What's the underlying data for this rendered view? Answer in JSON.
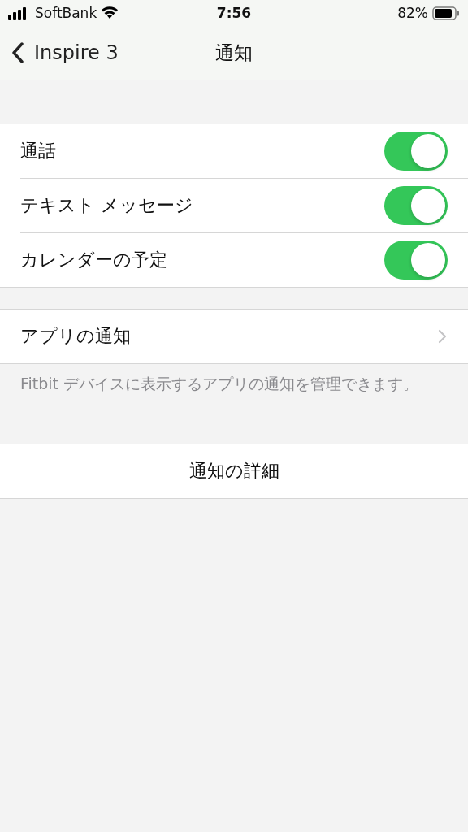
{
  "status_bar": {
    "carrier": "SoftBank",
    "time": "7:56",
    "battery": "82%"
  },
  "nav": {
    "back_label": "Inspire 3",
    "title": "通知"
  },
  "toggles": [
    {
      "label": "通話",
      "on": true
    },
    {
      "label": "テキスト メッセージ",
      "on": true
    },
    {
      "label": "カレンダーの予定",
      "on": true
    }
  ],
  "app_notifications": {
    "label": "アプリの通知"
  },
  "footer": "Fitbit デバイスに表示するアプリの通知を管理できます。",
  "details_button": "通知の詳細"
}
